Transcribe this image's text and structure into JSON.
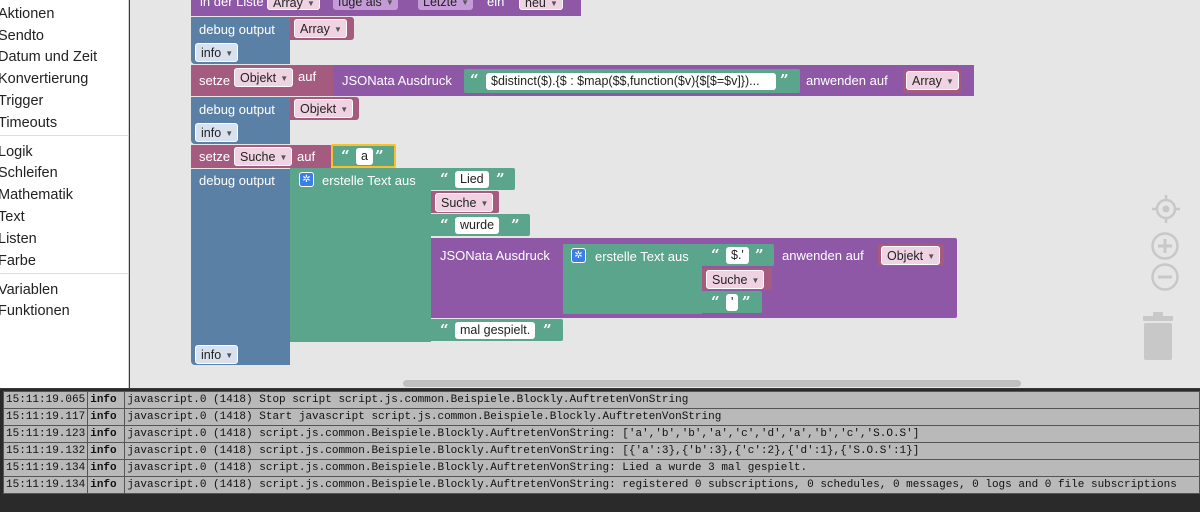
{
  "toolbox": {
    "categories": [
      "Aktionen",
      "Sendto",
      "Datum und Zeit",
      "Konvertierung",
      "Trigger",
      "Timeouts",
      "Logik",
      "Schleifen",
      "Mathematik",
      "Text",
      "Listen",
      "Farbe",
      "Variablen",
      "Funktionen"
    ]
  },
  "blocks": {
    "top_partial": {
      "label1": "in der Liste",
      "dd1": "Array",
      "dd2": "füge als",
      "dd3": "Letzte",
      "label2": "ein",
      "dd4": "neu"
    },
    "debug1": {
      "label": "debug output",
      "var": "Array",
      "level": "info"
    },
    "setze1": {
      "label": "setze",
      "var": "Objekt",
      "auf": "auf",
      "jsonata": "JSONata Ausdruck",
      "expr": "$distinct($).{$ : $map($$,function($v){$[$=$v]})...",
      "apply": "anwenden auf",
      "target": "Array"
    },
    "debug2": {
      "label": "debug output",
      "var": "Objekt",
      "level": "info"
    },
    "setze2": {
      "label": "setze",
      "var": "Suche",
      "auf": "auf",
      "text": "a"
    },
    "debug3": {
      "label": "debug output",
      "create_text": "erstelle Text aus",
      "t1": "Lied",
      "v1": "Suche",
      "t2": "wurde",
      "jsonata": "JSONata Ausdruck",
      "inner_create": "erstelle Text aus",
      "it1": "$.'",
      "iv1": "Suche",
      "it2": "'",
      "apply": "anwenden auf",
      "target": "Objekt",
      "t3": "mal gespielt.",
      "level": "info"
    }
  },
  "log": [
    {
      "time": "15:11:19.065",
      "level": "info",
      "msg": "javascript.0 (1418) Stop script script.js.common.Beispiele.Blockly.AuftretenVonString"
    },
    {
      "time": "15:11:19.117",
      "level": "info",
      "msg": "javascript.0 (1418) Start javascript script.js.common.Beispiele.Blockly.AuftretenVonString"
    },
    {
      "time": "15:11:19.123",
      "level": "info",
      "msg": "javascript.0 (1418) script.js.common.Beispiele.Blockly.AuftretenVonString: ['a','b','b','a','c','d','a','b','c','S.O.S']"
    },
    {
      "time": "15:11:19.132",
      "level": "info",
      "msg": "javascript.0 (1418) script.js.common.Beispiele.Blockly.AuftretenVonString: [{'a':3},{'b':3},{'c':2},{'d':1},{'S.O.S':1}]"
    },
    {
      "time": "15:11:19.134",
      "level": "info",
      "msg": "javascript.0 (1418) script.js.common.Beispiele.Blockly.AuftretenVonString: Lied a wurde 3 mal gespielt."
    },
    {
      "time": "15:11:19.134",
      "level": "info",
      "msg": "javascript.0 (1418) script.js.common.Beispiele.Blockly.AuftretenVonString: registered 0 subscriptions, 0 schedules, 0 messages, 0 logs and 0 file subscriptions"
    }
  ],
  "icons": {
    "target": "crosshair-icon",
    "zoom_in": "plus-icon",
    "zoom_out": "minus-icon",
    "trash": "trash-icon",
    "gear": "gear-icon",
    "dropdown": "chevron-down-icon"
  },
  "colors": {
    "workspace": "#e6e6e6",
    "debug_block": "#5b80a5",
    "variable_block": "#a55b80",
    "jsonata_block": "#8e58a6",
    "text_block": "#5ba58c",
    "selected_outline": "#f6c12b"
  }
}
